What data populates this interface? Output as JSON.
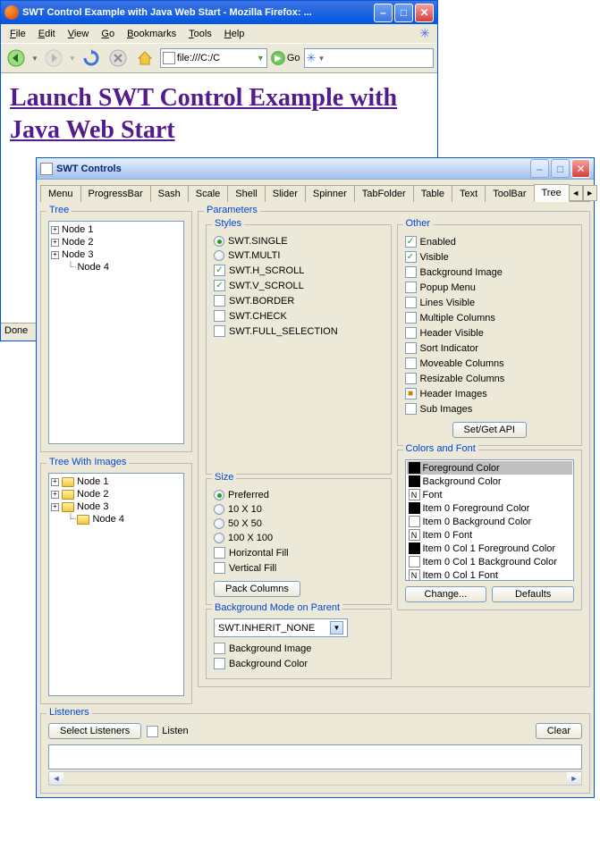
{
  "firefox": {
    "title": "SWT Control Example with Java Web Start - Mozilla Firefox: ...",
    "menu": [
      "File",
      "Edit",
      "View",
      "Go",
      "Bookmarks",
      "Tools",
      "Help"
    ],
    "url": "file:///C:/C",
    "go_label": "Go",
    "link_text": "Launch SWT Control Example with Java Web Start",
    "status": "Done"
  },
  "swt": {
    "title": "SWT Controls",
    "tabs": [
      "Menu",
      "ProgressBar",
      "Sash",
      "Scale",
      "Shell",
      "Slider",
      "Spinner",
      "TabFolder",
      "Table",
      "Text",
      "ToolBar",
      "Tree"
    ],
    "active_tab": "Tree",
    "tree_group": "Tree",
    "tree_images_group": "Tree With Images",
    "tree_nodes": [
      "Node 1",
      "Node 2",
      "Node 3",
      "Node 4"
    ],
    "params_group": "Parameters",
    "styles_group": "Styles",
    "styles": [
      {
        "label": "SWT.SINGLE",
        "type": "radio",
        "checked": true
      },
      {
        "label": "SWT.MULTI",
        "type": "radio",
        "checked": false
      },
      {
        "label": "SWT.H_SCROLL",
        "type": "check",
        "checked": true
      },
      {
        "label": "SWT.V_SCROLL",
        "type": "check",
        "checked": true
      },
      {
        "label": "SWT.BORDER",
        "type": "check",
        "checked": false
      },
      {
        "label": "SWT.CHECK",
        "type": "check",
        "checked": false
      },
      {
        "label": "SWT.FULL_SELECTION",
        "type": "check",
        "checked": false
      }
    ],
    "other_group": "Other",
    "other": [
      {
        "label": "Enabled",
        "checked": true
      },
      {
        "label": "Visible",
        "checked": true
      },
      {
        "label": "Background Image",
        "checked": false
      },
      {
        "label": "Popup Menu",
        "checked": false
      },
      {
        "label": "Lines Visible",
        "checked": false
      },
      {
        "label": "Multiple Columns",
        "checked": false
      },
      {
        "label": "Header Visible",
        "checked": false
      },
      {
        "label": "Sort Indicator",
        "checked": false
      },
      {
        "label": "Moveable Columns",
        "checked": false
      },
      {
        "label": "Resizable Columns",
        "checked": false
      },
      {
        "label": "Header Images",
        "checked": false,
        "orange": true
      },
      {
        "label": "Sub Images",
        "checked": false
      }
    ],
    "setget_btn": "Set/Get API",
    "size_group": "Size",
    "size": [
      {
        "label": "Preferred",
        "type": "radio",
        "checked": true
      },
      {
        "label": "10 X 10",
        "type": "radio",
        "checked": false
      },
      {
        "label": "50 X 50",
        "type": "radio",
        "checked": false
      },
      {
        "label": "100 X 100",
        "type": "radio",
        "checked": false
      },
      {
        "label": "Horizontal Fill",
        "type": "check",
        "checked": false
      },
      {
        "label": "Vertical Fill",
        "type": "check",
        "checked": false
      }
    ],
    "pack_btn": "Pack Columns",
    "colors_group": "Colors and Font",
    "colors": [
      {
        "label": "Foreground Color",
        "swatch": "black",
        "sel": true
      },
      {
        "label": "Background Color",
        "swatch": "black"
      },
      {
        "label": "Font",
        "swatch": "N"
      },
      {
        "label": "Item 0 Foreground Color",
        "swatch": "black"
      },
      {
        "label": "Item 0 Background Color",
        "swatch": "empty"
      },
      {
        "label": "Item 0 Font",
        "swatch": "N"
      },
      {
        "label": "Item 0 Col 1 Foreground Color",
        "swatch": "black"
      },
      {
        "label": "Item 0 Col 1 Background Color",
        "swatch": "empty"
      },
      {
        "label": "Item 0 Col 1 Font",
        "swatch": "N"
      }
    ],
    "change_btn": "Change...",
    "defaults_btn": "Defaults",
    "bgmode_group": "Background Mode on Parent",
    "bgmode_value": "SWT.INHERIT_NONE",
    "bgmode_checks": [
      "Background Image",
      "Background Color"
    ],
    "listeners_group": "Listeners",
    "select_listeners_btn": "Select Listeners",
    "listen_check": "Listen",
    "clear_btn": "Clear"
  }
}
